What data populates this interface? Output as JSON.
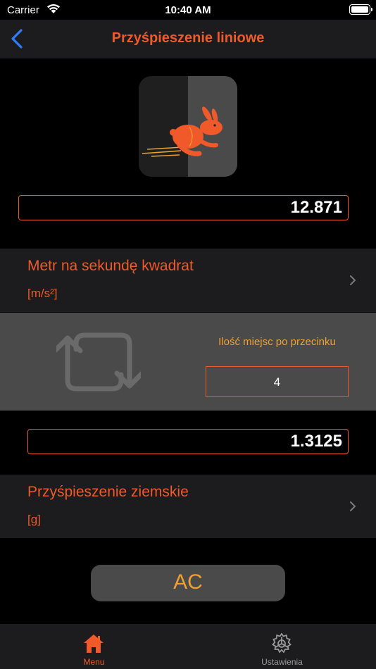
{
  "status": {
    "carrier": "Carrier",
    "time": "10:40 AM"
  },
  "nav": {
    "title": "Przyśpieszenie liniowe",
    "back_icon": "chevron-left-icon"
  },
  "input_value": "12.871",
  "from_unit": {
    "name": "Metr na sekundę kwadrat",
    "symbol": "[m/s²]"
  },
  "decimal": {
    "label": "Ilość miejsc po przecinku",
    "value": "4"
  },
  "result_value": "1.3125",
  "to_unit": {
    "name": "Przyśpieszenie ziemskie",
    "symbol": "[g]"
  },
  "ac_label": "AC",
  "tabs": [
    {
      "label": "Menu",
      "icon": "home-icon",
      "active": true
    },
    {
      "label": "Ustawienia",
      "icon": "gear-icon",
      "active": false
    }
  ],
  "colors": {
    "accent": "#f0592a",
    "secondary": "#f0a030",
    "panel": "#4a4a4a",
    "row": "#1c1c1e"
  }
}
